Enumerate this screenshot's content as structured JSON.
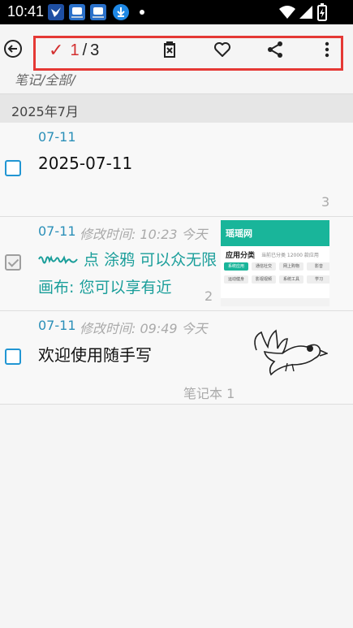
{
  "status_bar": {
    "time": "10:41",
    "icons": [
      "app-notification-icon",
      "app-notification-icon",
      "app-notification-icon",
      "download-icon",
      "dot-icon",
      "wifi-icon",
      "signal-icon",
      "battery-charging-icon"
    ]
  },
  "toolbar": {
    "back_icon": "back-arrow-icon",
    "check_icon": "✓",
    "selected": "1",
    "separator": "/",
    "total": "3",
    "actions": [
      "delete-icon",
      "favorite-icon",
      "share-icon",
      "more-icon"
    ]
  },
  "breadcrumb": "笔记/全部/",
  "section": {
    "label": "2025年7月"
  },
  "notes": [
    {
      "date": "07-11",
      "modified": "",
      "title": "2025-07-11",
      "count": "3",
      "checked": false
    },
    {
      "date": "07-11",
      "modified": "修改时间: 10:23 今天",
      "title": "点 涂鸦 可以众无限画布: 您可以享有近",
      "count": "2",
      "checked": true
    },
    {
      "date": "07-11",
      "modified": "修改时间: 09:49 今天",
      "title": "欢迎使用随手写",
      "notebook": "笔记本 1",
      "checked": false
    }
  ],
  "thumbnail": {
    "logo": "瑶瑶网",
    "heading": "应用分类",
    "meta": "当前已分类 12000 款应用",
    "chips": [
      "系统应用",
      "通信社交",
      "网上购物",
      "影音",
      "运动健身",
      "影视视频",
      "系统工具",
      "学习"
    ]
  },
  "colors": {
    "accent_red": "#e53935",
    "date_blue": "#2a8fb8",
    "doodle_teal": "#1a9e9a",
    "thumb_green": "#19b59a"
  }
}
